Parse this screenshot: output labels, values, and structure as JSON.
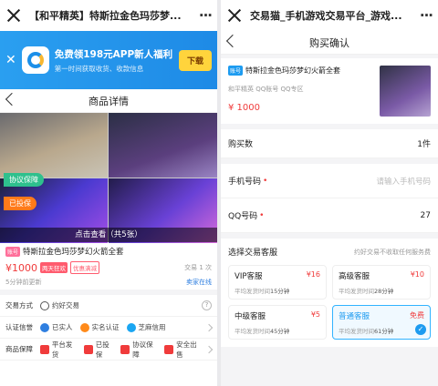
{
  "left": {
    "wechat_title": "【和平精英】特斯拉金色玛莎梦...",
    "banner": {
      "headline": "免费领198元APP新人福利",
      "sub": "第一时间获取收货、收款信息",
      "button": "下载"
    },
    "page_title": "商品详情",
    "gallery": {
      "tag_protect": "协议保障",
      "tag_insured": "已投保",
      "view_all": "点击查看（共5张）"
    },
    "product": {
      "badge": "账号",
      "title": "特斯拉金色玛莎梦幻火箭全套",
      "price": "¥1000",
      "chip_a": "两天狂欢",
      "chip_b": "优惠满减",
      "trades": "交易 1 次",
      "updated": "5分钟前更新",
      "seller_online": "卖家在线"
    },
    "trade_method": {
      "label": "交易方式",
      "value": "约好交易"
    },
    "certification": {
      "label": "认证信誉",
      "items": [
        "已实人",
        "实名认证",
        "芝麻信用"
      ]
    },
    "guarantee": {
      "label": "商品保障",
      "items": [
        "平台发货",
        "已投保",
        "协议保障",
        "安全出售"
      ]
    }
  },
  "right": {
    "wechat_title": "交易猫_手机游戏交易平台_游戏...",
    "page_title": "购买确认",
    "product": {
      "badge": "账号",
      "title": "特斯拉金色玛莎梦幻火箭全套",
      "meta": "和平精英 QQ账号 QQ专区",
      "price": "¥ 1000"
    },
    "qty": {
      "label": "购买数",
      "value": "1件"
    },
    "phone": {
      "label": "手机号码",
      "placeholder": "请输入手机号码"
    },
    "qq": {
      "label": "QQ号码",
      "value": "27"
    },
    "service": {
      "label": "选择交易客服",
      "hint": "约好交易不收取任何服务费",
      "options": [
        {
          "name": "VIP客服",
          "fee": "¥16",
          "sub_prefix": "平均发货时间",
          "time": "15分钟"
        },
        {
          "name": "高级客服",
          "fee": "¥10",
          "sub_prefix": "平均发货时间",
          "time": "28分钟"
        },
        {
          "name": "中级客服",
          "fee": "¥5",
          "sub_prefix": "平均发货时间",
          "time": "45分钟"
        },
        {
          "name": "普通客服",
          "fee": "免费",
          "sub_prefix": "平均发货时间",
          "time": "61分钟"
        }
      ]
    }
  },
  "colors": {
    "accent_blue": "#1d9bf0",
    "price_red": "#f03b3b",
    "banner_blue": "#2a9ff0",
    "download_yellow": "#ffd43c"
  }
}
